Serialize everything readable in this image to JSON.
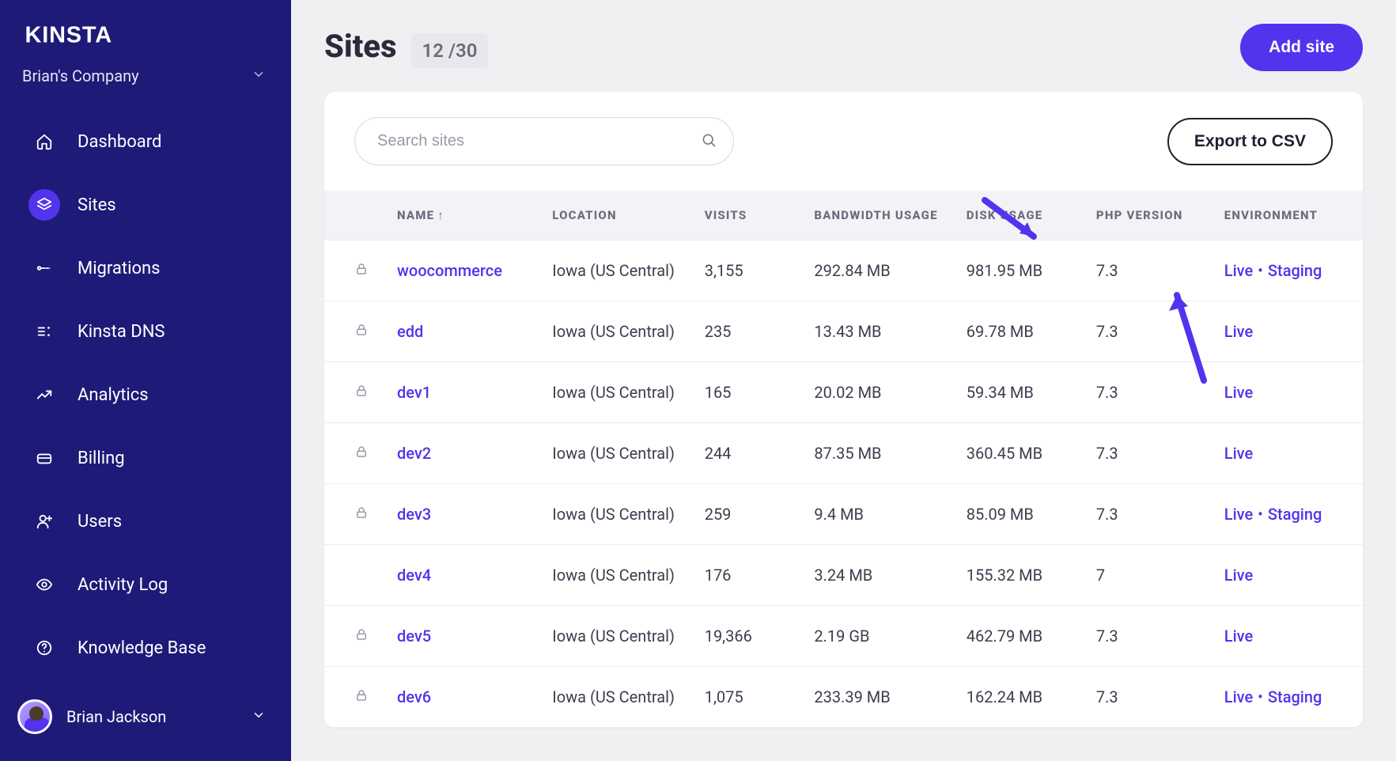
{
  "brand": "KINSTA",
  "company": {
    "name": "Brian's Company"
  },
  "nav": [
    {
      "key": "dashboard",
      "label": "Dashboard",
      "icon": "home"
    },
    {
      "key": "sites",
      "label": "Sites",
      "icon": "layers",
      "active": true
    },
    {
      "key": "migrations",
      "label": "Migrations",
      "icon": "migrate"
    },
    {
      "key": "dns",
      "label": "Kinsta DNS",
      "icon": "dns"
    },
    {
      "key": "analytics",
      "label": "Analytics",
      "icon": "trend"
    },
    {
      "key": "billing",
      "label": "Billing",
      "icon": "billing"
    },
    {
      "key": "users",
      "label": "Users",
      "icon": "user-plus"
    },
    {
      "key": "activity",
      "label": "Activity Log",
      "icon": "eye"
    },
    {
      "key": "kb",
      "label": "Knowledge Base",
      "icon": "help"
    }
  ],
  "user": {
    "name": "Brian Jackson"
  },
  "page": {
    "title": "Sites",
    "count": "12 /30",
    "add_button": "Add site",
    "search_placeholder": "Search sites",
    "export_button": "Export to CSV"
  },
  "columns": {
    "name": "NAME",
    "location": "LOCATION",
    "visits": "VISITS",
    "bandwidth": "BANDWIDTH USAGE",
    "disk": "DISK USAGE",
    "php": "PHP VERSION",
    "env": "ENVIRONMENT"
  },
  "rows": [
    {
      "locked": true,
      "name": "woocommerce",
      "location": "Iowa (US Central)",
      "visits": "3,155",
      "bandwidth": "292.84 MB",
      "disk": "981.95 MB",
      "php": "7.3",
      "env": [
        "Live",
        "Staging"
      ]
    },
    {
      "locked": true,
      "name": "edd",
      "location": "Iowa (US Central)",
      "visits": "235",
      "bandwidth": "13.43 MB",
      "disk": "69.78 MB",
      "php": "7.3",
      "env": [
        "Live"
      ]
    },
    {
      "locked": true,
      "name": "dev1",
      "location": "Iowa (US Central)",
      "visits": "165",
      "bandwidth": "20.02 MB",
      "disk": "59.34 MB",
      "php": "7.3",
      "env": [
        "Live"
      ]
    },
    {
      "locked": true,
      "name": "dev2",
      "location": "Iowa (US Central)",
      "visits": "244",
      "bandwidth": "87.35 MB",
      "disk": "360.45 MB",
      "php": "7.3",
      "env": [
        "Live"
      ]
    },
    {
      "locked": true,
      "name": "dev3",
      "location": "Iowa (US Central)",
      "visits": "259",
      "bandwidth": "9.4 MB",
      "disk": "85.09 MB",
      "php": "7.3",
      "env": [
        "Live",
        "Staging"
      ]
    },
    {
      "locked": false,
      "name": "dev4",
      "location": "Iowa (US Central)",
      "visits": "176",
      "bandwidth": "3.24 MB",
      "disk": "155.32 MB",
      "php": "7",
      "env": [
        "Live"
      ]
    },
    {
      "locked": true,
      "name": "dev5",
      "location": "Iowa (US Central)",
      "visits": "19,366",
      "bandwidth": "2.19 GB",
      "disk": "462.79 MB",
      "php": "7.3",
      "env": [
        "Live"
      ]
    },
    {
      "locked": true,
      "name": "dev6",
      "location": "Iowa (US Central)",
      "visits": "1,075",
      "bandwidth": "233.39 MB",
      "disk": "162.24 MB",
      "php": "7.3",
      "env": [
        "Live",
        "Staging"
      ]
    }
  ]
}
